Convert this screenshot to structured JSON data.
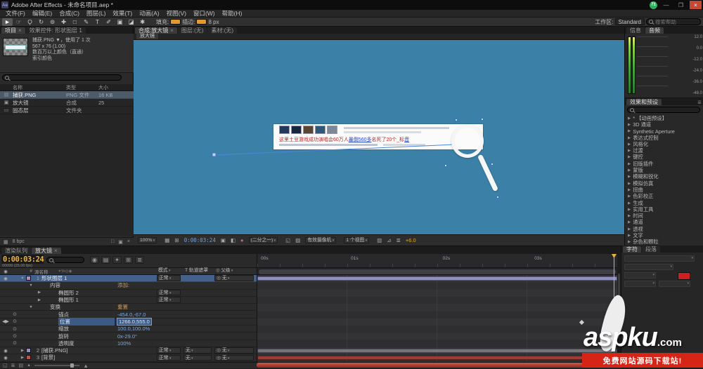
{
  "colors": {
    "canvas_blue": "#3b80a7",
    "accent_orange": "#e8b44a",
    "selection_blue": "#44618c",
    "value_blue": "#7fa8d9",
    "watermark_red": "#d62417",
    "fill_red": "#cc1f1f"
  },
  "title_bar": {
    "app_initials": "Ae",
    "title": "Adobe After Effects - 未命名项目.aep *",
    "badge": "71",
    "minimize": "—",
    "maximize": "❐",
    "close": "×"
  },
  "menu_bar": {
    "items": [
      "文件(F)",
      "编辑(E)",
      "合成(C)",
      "图层(L)",
      "效果(T)",
      "动画(A)",
      "视图(V)",
      "窗口(W)",
      "帮助(H)"
    ]
  },
  "toolbar": {
    "tools": [
      {
        "g": "►",
        "cls": "active"
      },
      {
        "g": "☞"
      },
      {
        "g": "Ϙ"
      },
      {
        "g": "↻"
      },
      {
        "g": "⊚"
      },
      {
        "g": "✚"
      },
      {
        "g": "□"
      },
      {
        "g": "✎"
      },
      {
        "g": "T"
      },
      {
        "g": "✐"
      },
      {
        "g": "▣"
      },
      {
        "g": "◪"
      },
      {
        "g": "✱"
      }
    ],
    "fill_label": "填充:",
    "stroke_label": "描边:",
    "stroke_width": "8 px",
    "workspace_label": "工作区:",
    "workspace_value": "Standard",
    "search_placeholder": "搜索帮助"
  },
  "project_panel": {
    "tabs": [
      {
        "label": "项目",
        "cls": "active",
        "x": "×"
      },
      {
        "label": "效果控件: 形状图层 1"
      }
    ],
    "preview": {
      "title": "捕获.PNG ▼",
      "usage": "，使用了 1 次",
      "line2": "567 x 76 (1.00)",
      "line3": "数百万以上颜色（直通）",
      "line4": "索引颜色"
    },
    "columns": [
      {
        "label": "名称"
      },
      {
        "label": "类型"
      },
      {
        "label": "大小"
      }
    ],
    "rows": [
      {
        "icon": "▤",
        "name": "捕获.PNG",
        "type": "PNG 文件",
        "size": "16 KB",
        "cls": "sel"
      },
      {
        "icon": "▣",
        "name": "放大镜",
        "type": "合成",
        "size": "25"
      },
      {
        "icon": "▭",
        "name": "固态层",
        "type": "文件夹",
        "size": ""
      }
    ],
    "footer_bpc": "8 bpc",
    "footer_icons": [
      "▦",
      "□",
      "▣",
      "×"
    ]
  },
  "viewer": {
    "tabs": [
      {
        "label": "合成:放大镜",
        "cls": "active",
        "x": "×"
      },
      {
        "label": "图层:(无)"
      },
      {
        "label": "素材:(无)"
      }
    ],
    "breadcrumb": "放大镜",
    "banner": {
      "thumbs": [
        {
          "chip": "#24385c"
        },
        {
          "chip": "#17273f"
        },
        {
          "chip": "#5a4632"
        },
        {
          "chip": "#2e5878"
        },
        {
          "chip": "#7c8898"
        }
      ],
      "headline": [
        {
          "t": "这里土豆游戏成功演唱会60万人",
          "color": "#c02222"
        },
        {
          "t": "暴倒560多",
          "color": "#2244c0",
          "cls": "hl"
        },
        {
          "t": "名死了20个_标",
          "color": "#c02222"
        },
        {
          "t": "音",
          "color": "#2244c0",
          "cls": "hl"
        }
      ]
    },
    "statusbar": [
      {
        "t": "100%",
        "cls": "dd"
      },
      {
        "t": "▦"
      },
      {
        "t": "⊞"
      },
      {
        "t": "0:00:03:24",
        "cls": "tc"
      },
      {
        "t": "▣"
      },
      {
        "t": "◧"
      },
      {
        "t": "●",
        "cls": "rgb"
      },
      {
        "t": "(二分之一)",
        "cls": "dd"
      },
      {
        "t": "◱"
      },
      {
        "t": "▨"
      },
      {
        "t": "有效摄像机",
        "cls": "dd"
      },
      {
        "t": "1 个视图",
        "cls": "dd"
      },
      {
        "t": "▥"
      },
      {
        "t": "⊿"
      },
      {
        "t": "≣"
      },
      {
        "t": "+6.0",
        "cls": "exp"
      }
    ]
  },
  "audio_panel": {
    "tabs": [
      {
        "label": "信息"
      },
      {
        "label": "音频",
        "cls": "active"
      }
    ],
    "db_labels": [
      "12.0",
      "0.0",
      "-12.0",
      "-24.0",
      "-36.0",
      "-48.0"
    ]
  },
  "effects_panel": {
    "title": "效果和预设",
    "items": [
      "* 【动画预设】",
      "3D 通道",
      "Synthetic Aperture",
      "表达式控制",
      "风格化",
      "过渡",
      "键控",
      "旧版插件",
      "蒙版",
      "模糊和锐化",
      "模拟仿真",
      "扭曲",
      "色彩校正",
      "生成",
      "实用工具",
      "时间",
      "通道",
      "透视",
      "文字",
      "杂色和颗粒"
    ]
  },
  "timeline": {
    "tabs": [
      {
        "label": "渲染队列"
      },
      {
        "label": "放大镜",
        "cls": "active",
        "x": "×"
      }
    ],
    "timecode": "0:00:03:24",
    "frame_info": "00099 (25.00 fps)",
    "header_icons": [
      "◉",
      "▤",
      "✦",
      "⊞",
      "≣"
    ],
    "columns": {
      "eye": "◉",
      "hash": "#",
      "name": "源名称",
      "switches": "✦\\fx◎◉",
      "mode": "模式",
      "trkmat": "T 轨道遮罩",
      "parent": "父级"
    },
    "rows": [
      {
        "cls": "t-layer sel",
        "av": "◉",
        "twirl": "▼",
        "index": "1",
        "chip": "#b48ead",
        "label": "形状图层 1",
        "mode": "正常",
        "parent": "无"
      },
      {
        "cls": "t-group ind1 linkish",
        "twirl": "▼",
        "label": "内容",
        "value": "添加:"
      },
      {
        "cls": "t-item ind2",
        "twirl": "▶",
        "label": "椭圆形 2",
        "mode": "正常"
      },
      {
        "cls": "t-item ind2",
        "twirl": "▶",
        "label": "椭圆形 1",
        "mode": "正常"
      },
      {
        "cls": "t-group ind1 linkish",
        "twirl": "▼",
        "label": "变换",
        "value": "重置"
      },
      {
        "cls": "t-prop ind2",
        "sw": "⊙",
        "label": "锚点",
        "value": "-454.0,-67.0"
      },
      {
        "cls": "t-prop ind2 editing",
        "av": "◀ ▶",
        "sw": "⊙",
        "label": "位置",
        "value": "1266.0,555.0"
      },
      {
        "cls": "t-prop ind2",
        "sw": "⊙",
        "label": "缩放",
        "value": "100.0,100.0%"
      },
      {
        "cls": "t-prop ind2",
        "sw": "⊙",
        "label": "旋转",
        "value": "0x-29.0°"
      },
      {
        "cls": "t-prop ind2",
        "sw": "⊙",
        "label": "透明度",
        "value": "100%"
      },
      {
        "cls": "t-layer",
        "av": "◉",
        "twirl": "▶",
        "index": "2",
        "chip": "#8f8fc2",
        "label": "[捕获.PNG]",
        "mode": "正常",
        "trkmat": "无",
        "parent": "无"
      },
      {
        "cls": "t-layer",
        "av": "◉",
        "twirl": "▶",
        "index": "3",
        "chip": "#c05050",
        "label": "[背景]",
        "mode": "正常",
        "trkmat": "无",
        "parent": "无"
      }
    ],
    "ruler_labels": [
      {
        "label": "00s",
        "pos": 0.01
      },
      {
        "label": "01s",
        "pos": 0.26
      },
      {
        "label": "02s",
        "pos": 0.515
      },
      {
        "label": "03s",
        "pos": 0.77
      }
    ],
    "bars": [
      {
        "row": 0,
        "left": 0.0,
        "width": 1.0,
        "color": "#8f8fc2"
      },
      {
        "row": 10,
        "left": 0.0,
        "width": 1.0,
        "color": "#74747c"
      },
      {
        "row": 11,
        "left": 0.0,
        "width": 1.0,
        "color": "#9e3a34"
      }
    ],
    "keyframes": [
      {
        "row": 6,
        "pos": 0.9
      },
      {
        "row": 6,
        "pos": 0.985
      }
    ],
    "cti_pos": 0.998
  },
  "character_panel": {
    "tabs": [
      {
        "label": "字符",
        "cls": "active"
      },
      {
        "label": "段落"
      }
    ],
    "fill_color": "#cc1f1f"
  },
  "watermark": {
    "brand": "aspku",
    "tld": ".com",
    "tagline": "免费网站源码下载站!"
  }
}
